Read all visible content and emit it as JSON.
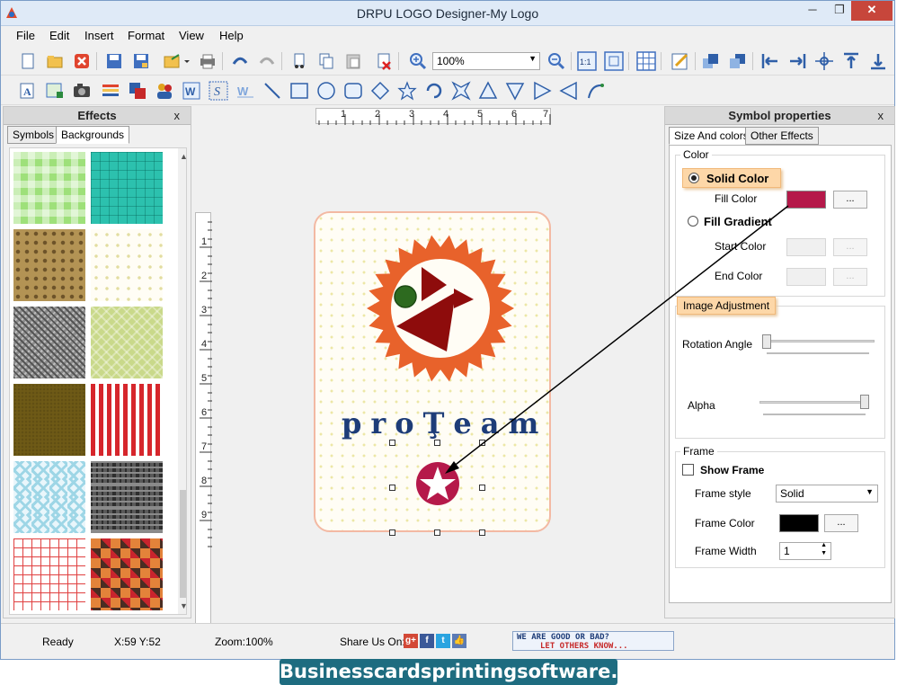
{
  "window": {
    "title": "DRPU LOGO Designer-My Logo",
    "minimize": "─",
    "restore": "❐",
    "close": "✕"
  },
  "menu": [
    "File",
    "Edit",
    "Insert",
    "Format",
    "View",
    "Help"
  ],
  "toolbar": {
    "zoom_value": "100%"
  },
  "effects": {
    "title": "Effects",
    "close": "x",
    "tabs": [
      "Symbols",
      "Backgrounds"
    ],
    "active_tab": "Backgrounds"
  },
  "rulers": {
    "horizontal": [
      "1",
      "2",
      "3",
      "4",
      "5",
      "6",
      "7"
    ],
    "vertical": [
      "1",
      "2",
      "3",
      "4",
      "5",
      "6",
      "7",
      "8",
      "9"
    ]
  },
  "canvas": {
    "brand_text": "proŢeam",
    "accent_colors": {
      "gear": "#e8622b",
      "triangle": "#8e0c0c",
      "circle": "#2d6a1f",
      "star_badge": "#b5194a"
    }
  },
  "symbol_properties": {
    "title": "Symbol properties",
    "close": "x",
    "tabs": [
      "Size And colors",
      "Other Effects"
    ],
    "color_group": "Color",
    "solid_color": "Solid Color",
    "fill_color_label": "Fill Color",
    "fill_color_value": "#b5194a",
    "fill_gradient": "Fill Gradient",
    "start_color": "Start Color",
    "end_color": "End Color",
    "browse": "...",
    "image_adjustment": "Image Adjustment",
    "rotation_angle": "Rotation Angle",
    "alpha": "Alpha",
    "frame_group": "Frame",
    "show_frame": "Show Frame",
    "frame_style_label": "Frame style",
    "frame_style_value": "Solid",
    "frame_color_label": "Frame Color",
    "frame_color_value": "#000000",
    "frame_width_label": "Frame Width",
    "frame_width_value": "1"
  },
  "status": {
    "ready": "Ready",
    "coords": "X:59  Y:52",
    "zoom": "Zoom:100%",
    "share": "Share Us On:",
    "feedback_line1": "WE ARE GOOD OR BAD?",
    "feedback_line2": "LET OTHERS KNOW..."
  },
  "footer": {
    "banner": "Businesscardsprintingsoftware.com"
  }
}
